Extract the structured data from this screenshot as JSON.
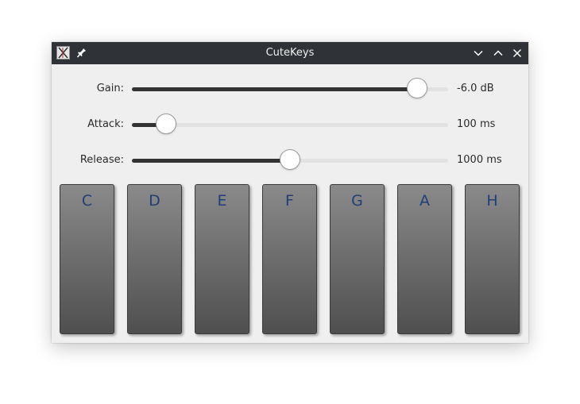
{
  "window": {
    "title": "CuteKeys",
    "icons": [
      "app-icon",
      "pin-icon",
      "minimize-icon",
      "maximize-icon",
      "close-icon"
    ]
  },
  "sliders": [
    {
      "label": "Gain:",
      "value_text": "-6.0 dB",
      "fraction": 0.93
    },
    {
      "label": "Attack:",
      "value_text": "100 ms",
      "fraction": 0.08
    },
    {
      "label": "Release:",
      "value_text": "1000 ms",
      "fraction": 0.5
    }
  ],
  "keys": [
    "C",
    "D",
    "E",
    "F",
    "G",
    "A",
    "H"
  ],
  "colors": {
    "titlebar": "#2f3337",
    "window_bg": "#efefef",
    "key_top": "#8a8a8a",
    "key_bottom": "#4f4f4f",
    "key_label": "#1f3f78",
    "slider_fill": "#333333"
  }
}
